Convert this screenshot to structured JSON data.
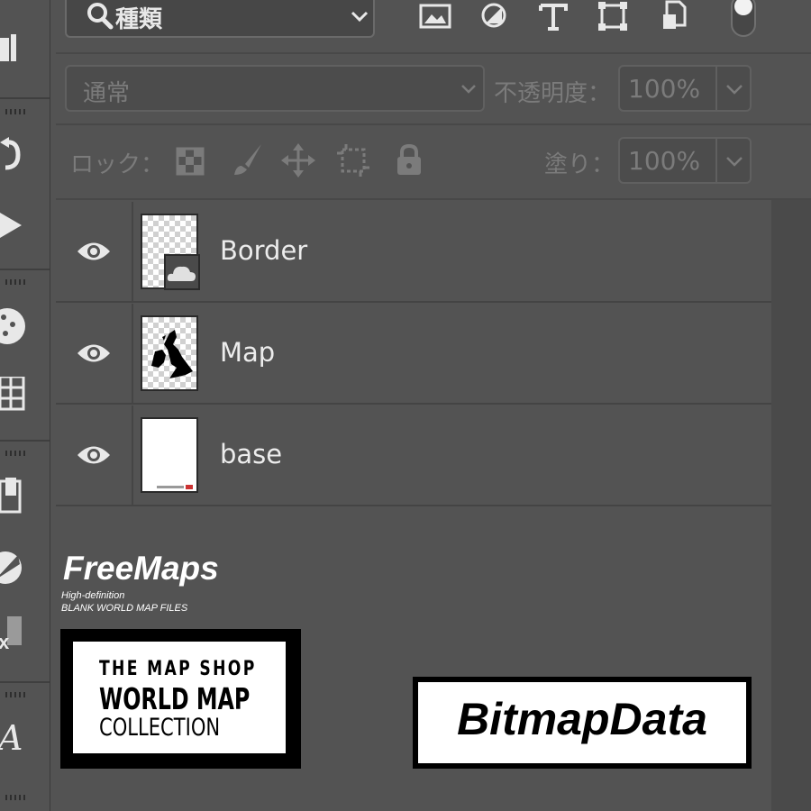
{
  "filter": {
    "label": "種類"
  },
  "blend": {
    "mode": "通常",
    "opacity_label": "不透明度：",
    "opacity_value": "100%"
  },
  "lock": {
    "label": "ロック：",
    "fill_label": "塗り：",
    "fill_value": "100%"
  },
  "layers": [
    {
      "name": "Border",
      "visible": true
    },
    {
      "name": "Map",
      "visible": true
    },
    {
      "name": "base",
      "visible": true
    }
  ],
  "logos": {
    "freemaps": {
      "title": "FreeMaps",
      "line1": "High-definition",
      "line2": "BLANK WORLD MAP FILES"
    },
    "mapshop": {
      "line1": "THE MAP SHOP",
      "line2": "WORLD MAP",
      "line3": "COLLECTION"
    },
    "bitmapdata": "BitmapData"
  },
  "colors": {
    "panel_bg": "#535353",
    "text": "#ececec",
    "dim_text": "#7b7b7b"
  }
}
